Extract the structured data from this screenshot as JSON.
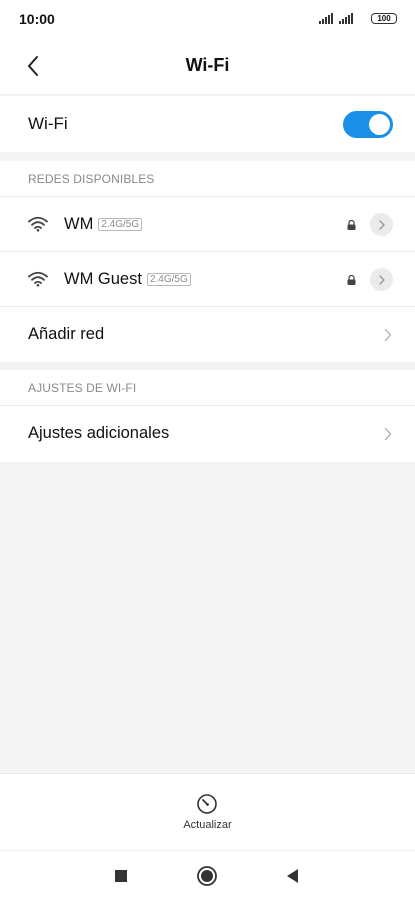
{
  "status_bar": {
    "time": "10:00",
    "battery": "100"
  },
  "header": {
    "title": "Wi-Fi",
    "back_icon": "chevron-left-icon"
  },
  "wifi_toggle": {
    "label": "Wi-Fi",
    "enabled": true,
    "accent_color": "#1a8fe8"
  },
  "available_networks": {
    "heading": "REDES DISPONIBLES",
    "networks": [
      {
        "name": "WM",
        "band": "2.4G/5G",
        "secured": true,
        "icon": "wifi-icon"
      },
      {
        "name": "WM Guest",
        "band": "2.4G/5G",
        "secured": true,
        "icon": "wifi-icon"
      }
    ],
    "add_network_label": "Añadir red"
  },
  "wifi_settings": {
    "heading": "AJUSTES DE WI-FI",
    "additional_settings_label": "Ajustes adicionales"
  },
  "refresh": {
    "label": "Actualizar",
    "icon": "refresh-icon"
  },
  "nav_bar": {
    "recents_icon": "square-icon",
    "home_icon": "circle-icon",
    "back_icon": "triangle-back-icon"
  }
}
